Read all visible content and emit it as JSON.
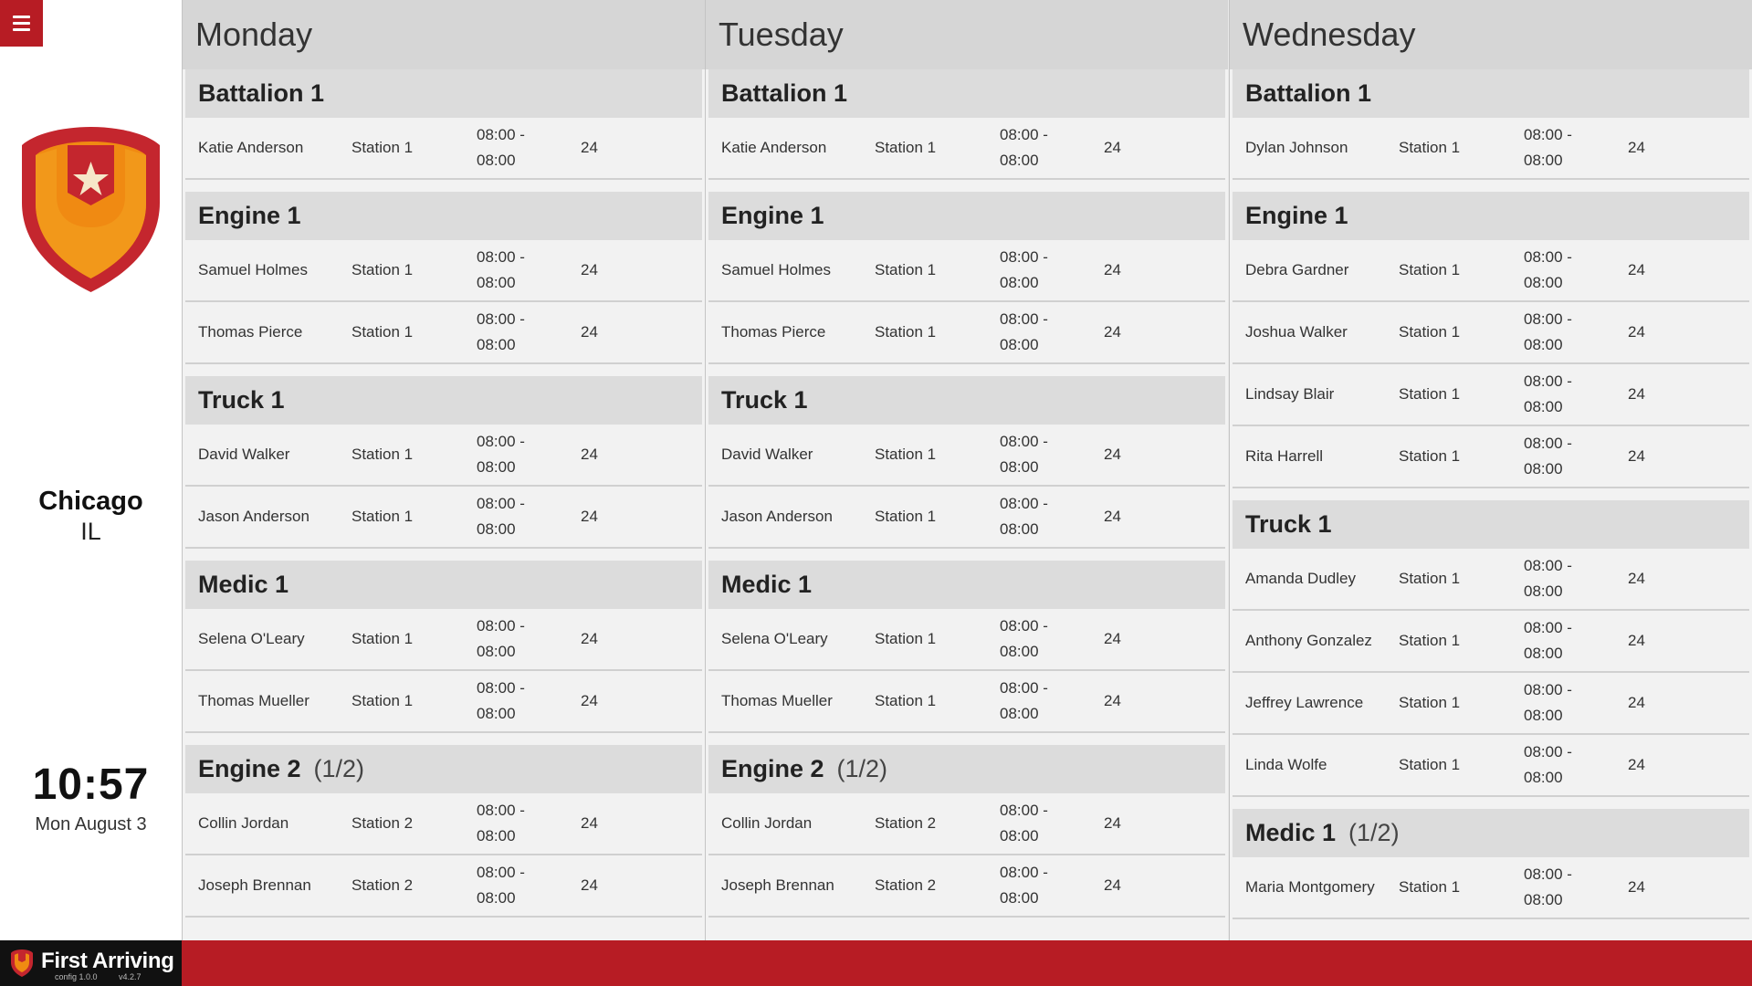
{
  "sidebar": {
    "city": "Chicago",
    "state": "IL",
    "time": "10:57",
    "date": "Mon August 3"
  },
  "branding": {
    "name": "First Arriving",
    "config": "config 1.0.0",
    "version": "v4.2.7"
  },
  "colors": {
    "brand_red": "#b71c24",
    "logo_orange": "#f08a12",
    "header_gray": "#d6d6d6"
  },
  "days": [
    {
      "name": "Monday",
      "units": [
        {
          "name": "Battalion 1",
          "count": "",
          "rows": [
            {
              "name": "Katie Anderson",
              "station": "Station 1",
              "time_start": "08:00 -",
              "time_end": "08:00",
              "hours": "24"
            }
          ]
        },
        {
          "name": "Engine 1",
          "count": "",
          "rows": [
            {
              "name": "Samuel Holmes",
              "station": "Station 1",
              "time_start": "08:00 -",
              "time_end": "08:00",
              "hours": "24"
            },
            {
              "name": "Thomas Pierce",
              "station": "Station 1",
              "time_start": "08:00 -",
              "time_end": "08:00",
              "hours": "24"
            }
          ]
        },
        {
          "name": "Truck 1",
          "count": "",
          "rows": [
            {
              "name": "David Walker",
              "station": "Station 1",
              "time_start": "08:00 -",
              "time_end": "08:00",
              "hours": "24"
            },
            {
              "name": "Jason Anderson",
              "station": "Station 1",
              "time_start": "08:00 -",
              "time_end": "08:00",
              "hours": "24"
            }
          ]
        },
        {
          "name": "Medic 1",
          "count": "",
          "rows": [
            {
              "name": "Selena O'Leary",
              "station": "Station 1",
              "time_start": "08:00 -",
              "time_end": "08:00",
              "hours": "24"
            },
            {
              "name": "Thomas Mueller",
              "station": "Station 1",
              "time_start": "08:00 -",
              "time_end": "08:00",
              "hours": "24"
            }
          ]
        },
        {
          "name": "Engine 2",
          "count": "(1/2)",
          "rows": [
            {
              "name": "Collin Jordan",
              "station": "Station 2",
              "time_start": "08:00 -",
              "time_end": "08:00",
              "hours": "24"
            },
            {
              "name": "Joseph Brennan",
              "station": "Station 2",
              "time_start": "08:00 -",
              "time_end": "08:00",
              "hours": "24"
            }
          ]
        }
      ]
    },
    {
      "name": "Tuesday",
      "units": [
        {
          "name": "Battalion 1",
          "count": "",
          "rows": [
            {
              "name": "Katie Anderson",
              "station": "Station 1",
              "time_start": "08:00 -",
              "time_end": "08:00",
              "hours": "24"
            }
          ]
        },
        {
          "name": "Engine 1",
          "count": "",
          "rows": [
            {
              "name": "Samuel Holmes",
              "station": "Station 1",
              "time_start": "08:00 -",
              "time_end": "08:00",
              "hours": "24"
            },
            {
              "name": "Thomas Pierce",
              "station": "Station 1",
              "time_start": "08:00 -",
              "time_end": "08:00",
              "hours": "24"
            }
          ]
        },
        {
          "name": "Truck 1",
          "count": "",
          "rows": [
            {
              "name": "David Walker",
              "station": "Station 1",
              "time_start": "08:00 -",
              "time_end": "08:00",
              "hours": "24"
            },
            {
              "name": "Jason Anderson",
              "station": "Station 1",
              "time_start": "08:00 -",
              "time_end": "08:00",
              "hours": "24"
            }
          ]
        },
        {
          "name": "Medic 1",
          "count": "",
          "rows": [
            {
              "name": "Selena O'Leary",
              "station": "Station 1",
              "time_start": "08:00 -",
              "time_end": "08:00",
              "hours": "24"
            },
            {
              "name": "Thomas Mueller",
              "station": "Station 1",
              "time_start": "08:00 -",
              "time_end": "08:00",
              "hours": "24"
            }
          ]
        },
        {
          "name": "Engine 2",
          "count": "(1/2)",
          "rows": [
            {
              "name": "Collin Jordan",
              "station": "Station 2",
              "time_start": "08:00 -",
              "time_end": "08:00",
              "hours": "24"
            },
            {
              "name": "Joseph Brennan",
              "station": "Station 2",
              "time_start": "08:00 -",
              "time_end": "08:00",
              "hours": "24"
            }
          ]
        }
      ]
    },
    {
      "name": "Wednesday",
      "units": [
        {
          "name": "Battalion 1",
          "count": "",
          "rows": [
            {
              "name": "Dylan Johnson",
              "station": "Station 1",
              "time_start": "08:00 -",
              "time_end": "08:00",
              "hours": "24"
            }
          ]
        },
        {
          "name": "Engine 1",
          "count": "",
          "rows": [
            {
              "name": "Debra Gardner",
              "station": "Station 1",
              "time_start": "08:00 -",
              "time_end": "08:00",
              "hours": "24"
            },
            {
              "name": "Joshua Walker",
              "station": "Station 1",
              "time_start": "08:00 -",
              "time_end": "08:00",
              "hours": "24"
            },
            {
              "name": "Lindsay Blair",
              "station": "Station 1",
              "time_start": "08:00 -",
              "time_end": "08:00",
              "hours": "24"
            },
            {
              "name": "Rita Harrell",
              "station": "Station 1",
              "time_start": "08:00 -",
              "time_end": "08:00",
              "hours": "24"
            }
          ]
        },
        {
          "name": "Truck 1",
          "count": "",
          "rows": [
            {
              "name": "Amanda Dudley",
              "station": "Station 1",
              "time_start": "08:00 -",
              "time_end": "08:00",
              "hours": "24"
            },
            {
              "name": "Anthony Gonzalez",
              "station": "Station 1",
              "time_start": "08:00 -",
              "time_end": "08:00",
              "hours": "24"
            },
            {
              "name": "Jeffrey Lawrence",
              "station": "Station 1",
              "time_start": "08:00 -",
              "time_end": "08:00",
              "hours": "24"
            },
            {
              "name": "Linda Wolfe",
              "station": "Station 1",
              "time_start": "08:00 -",
              "time_end": "08:00",
              "hours": "24"
            }
          ]
        },
        {
          "name": "Medic 1",
          "count": "(1/2)",
          "rows": [
            {
              "name": "Maria Montgomery",
              "station": "Station 1",
              "time_start": "08:00 -",
              "time_end": "08:00",
              "hours": "24"
            }
          ]
        }
      ]
    }
  ]
}
